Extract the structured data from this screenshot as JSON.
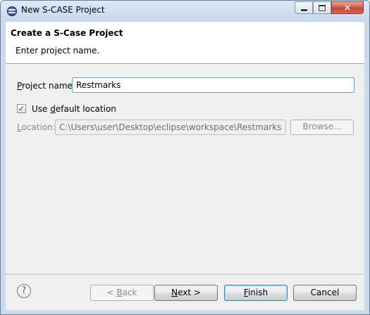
{
  "window": {
    "title": "New S-CASE Project",
    "controls": {
      "minimize": "minimize-icon",
      "maximize": "maximize-icon",
      "close": "×"
    }
  },
  "header": {
    "title": "Create a S-Case Project",
    "description": "Enter project name."
  },
  "form": {
    "project_name": {
      "label_prefix": "",
      "label_mnemonic": "P",
      "label_rest": "roject name:",
      "value": "Restmarks"
    },
    "default_location": {
      "checked": true,
      "check_glyph": "✓",
      "label_prefix": "Use ",
      "label_mnemonic": "d",
      "label_rest": "efault location"
    },
    "location": {
      "label_mnemonic": "L",
      "label_rest": "ocation:",
      "value": "C:\\Users\\user\\Desktop\\eclipse\\workspace\\Restmarks",
      "enabled": false
    },
    "browse_label": "Browse..."
  },
  "footer": {
    "help_glyph": "?",
    "back": {
      "prefix": "< ",
      "mnemonic": "B",
      "rest": "ack",
      "enabled": false
    },
    "next": {
      "mnemonic": "N",
      "rest": "ext >"
    },
    "finish": {
      "mnemonic": "F",
      "rest": "inish"
    },
    "cancel": "Cancel"
  }
}
